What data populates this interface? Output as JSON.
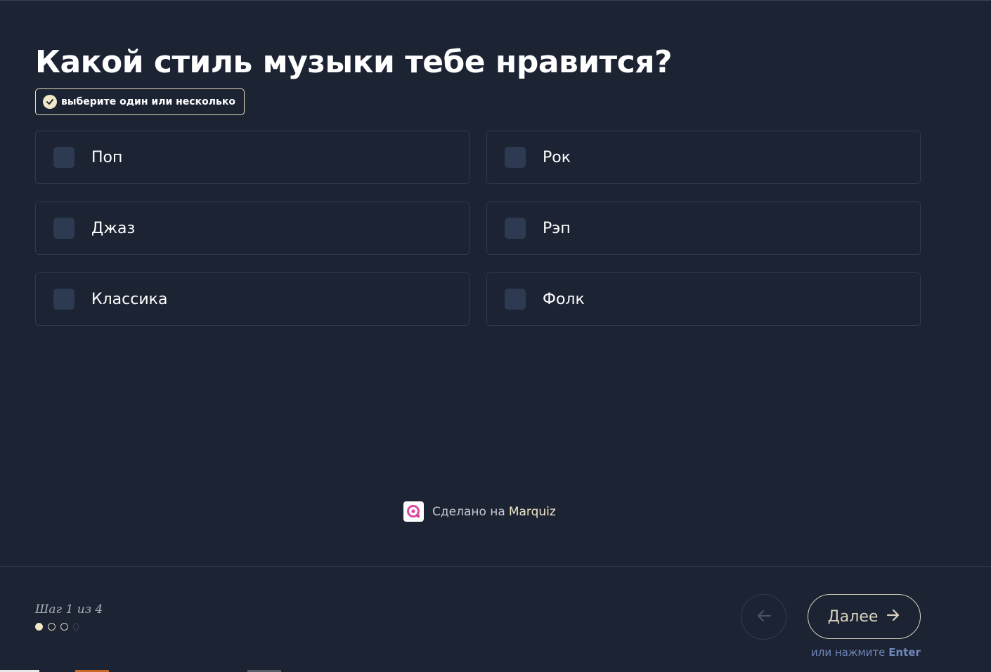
{
  "question": {
    "title": "Какой стиль музыки тебе нравится?",
    "hint": "выберите один или несколько",
    "hint_icon": "check-circle-icon"
  },
  "options": [
    {
      "label": "Поп",
      "checked": false
    },
    {
      "label": "Рок",
      "checked": false
    },
    {
      "label": "Джаз",
      "checked": false
    },
    {
      "label": "Рэп",
      "checked": false
    },
    {
      "label": "Классика",
      "checked": false
    },
    {
      "label": "Фолк",
      "checked": false
    }
  ],
  "made_by": {
    "text": "Сделано на",
    "brand": "Marquiz",
    "icon": "marquiz-logo-icon"
  },
  "footer": {
    "step_text": "Шаг 1 из 4",
    "current_step": 1,
    "total_steps": 4,
    "back_icon": "arrow-left-icon",
    "next_label": "Далее",
    "next_icon": "arrow-right-icon",
    "enter_hint_text": "или нажмите",
    "enter_hint_key": "Enter"
  },
  "colors": {
    "background": "#1c2333",
    "accent": "#f1e6c6",
    "checkbox": "#2e3a52",
    "link": "#6f86b8"
  }
}
